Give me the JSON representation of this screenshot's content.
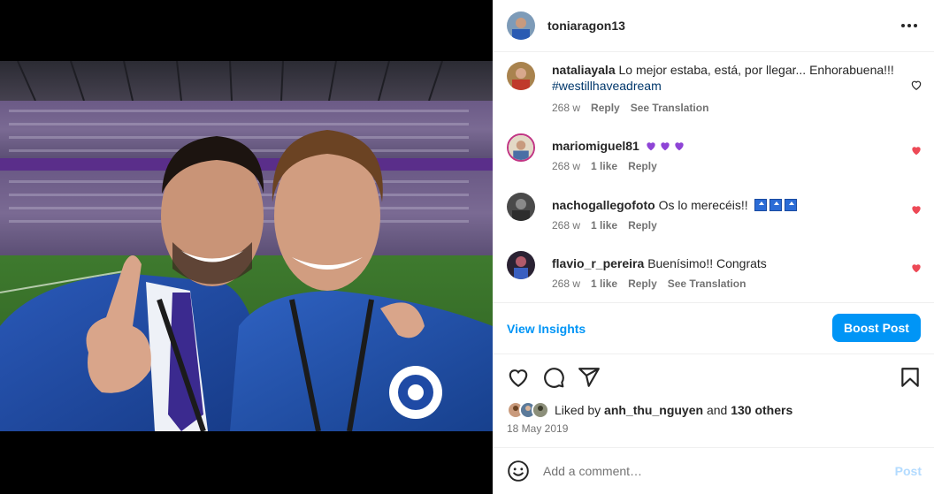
{
  "post": {
    "username": "toniaragon13",
    "more_icon": "more-horizontal-icon"
  },
  "comments": [
    {
      "username": "nataliayala",
      "text": "Lo mejor estaba, está, por llegar... Enhorabuena!!!",
      "hashtag": "#westillhaveadream",
      "time": "268 w",
      "likes": "",
      "reply": "Reply",
      "translate": "See Translation",
      "liked": false
    },
    {
      "username": "mariomiguel81",
      "text": "",
      "emoji": "purple-heart x3",
      "time": "268 w",
      "likes": "1 like",
      "reply": "Reply",
      "liked": true
    },
    {
      "username": "nachogallegofoto",
      "text": "Os lo merecéis!!",
      "emoji": "top-arrow x3",
      "time": "268 w",
      "likes": "1 like",
      "reply": "Reply",
      "liked": true
    },
    {
      "username": "flavio_r_pereira",
      "text": "Buenísimo!! Congrats",
      "time": "268 w",
      "likes": "1 like",
      "reply": "Reply",
      "translate": "See Translation",
      "liked": true
    }
  ],
  "insights": {
    "view_label": "View Insights",
    "boost_label": "Boost Post"
  },
  "likes": {
    "prefix": "Liked by",
    "user": "anh_thu_nguyen",
    "and": "and",
    "others": "130 others"
  },
  "date": "18 May 2019",
  "add_comment": {
    "placeholder": "Add a comment…",
    "post_label": "Post"
  },
  "colors": {
    "accent": "#0095f6",
    "heart_red": "#ed4956",
    "meta_gray": "#737373"
  }
}
